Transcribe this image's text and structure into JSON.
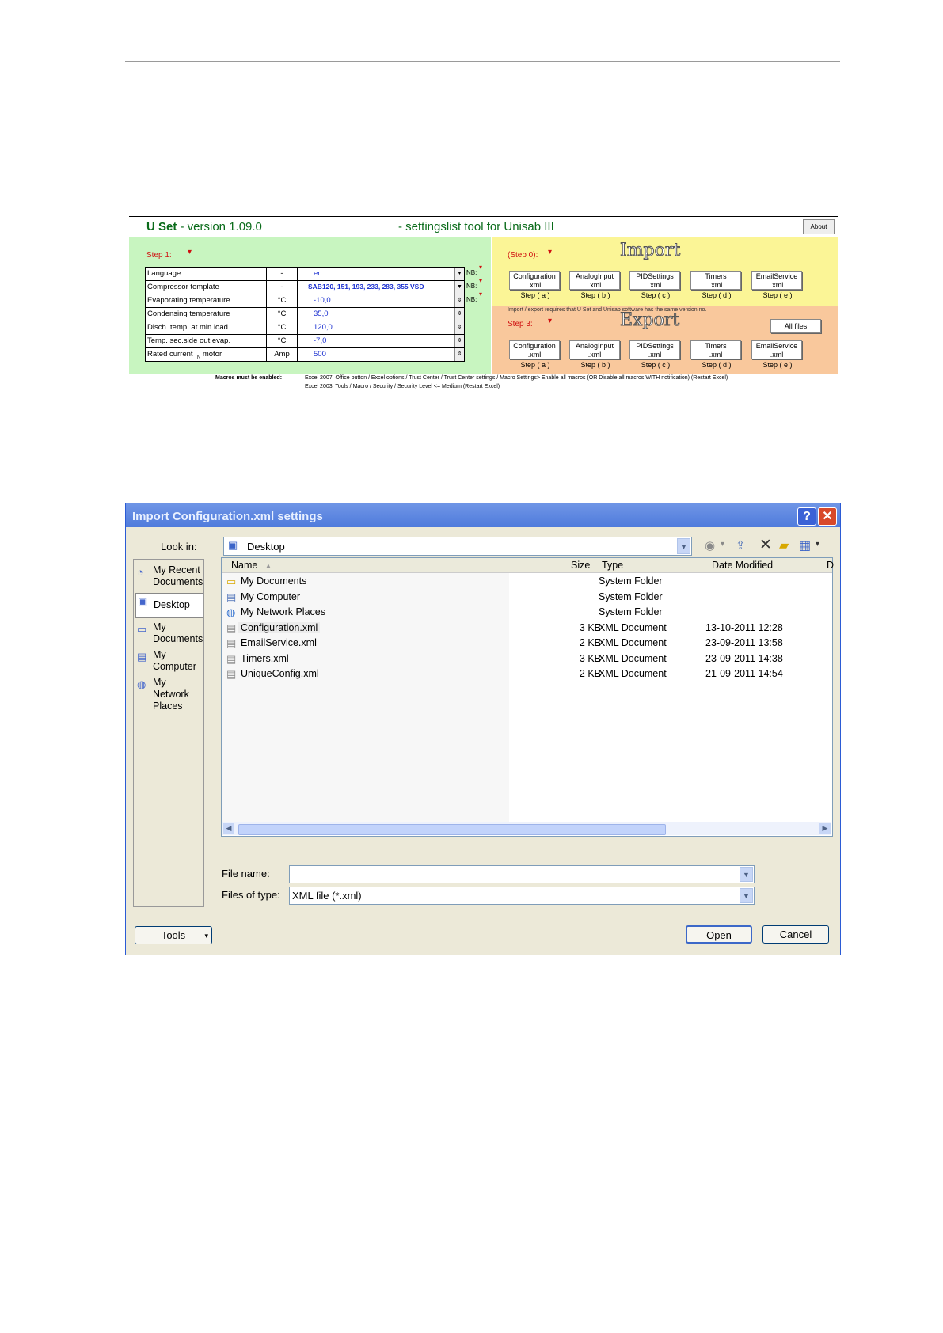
{
  "useet": {
    "title_main": "U Set",
    "title_version": " - version 1.09.0",
    "title_sub": "- settingslist tool for Unisab III",
    "about_label": "About",
    "step1_label": "Step 1:",
    "params": [
      {
        "name": "Language",
        "unit": "-",
        "value": "en",
        "nb": "NB:",
        "has_dd": true
      },
      {
        "name": "Compressor template",
        "unit": "-",
        "value": "SAB120, 151, 193, 233, 283, 355 VSD",
        "nb": "NB:",
        "has_dd": true
      },
      {
        "name": "Evaporating temperature",
        "unit": "°C",
        "value": "-10,0",
        "nb": "NB:",
        "has_dd": false
      },
      {
        "name": "Condensing temperature",
        "unit": "°C",
        "value": "35,0",
        "nb": "",
        "has_dd": false
      },
      {
        "name": "Disch. temp. at min load",
        "unit": "°C",
        "value": "120,0",
        "nb": "",
        "has_dd": false
      },
      {
        "name": "Temp. sec.side out evap.",
        "unit": "°C",
        "value": "-7,0",
        "nb": "",
        "has_dd": false
      },
      {
        "name": "Rated current I",
        "name_sub": "N",
        "name_end": " motor",
        "unit": "Amp",
        "value": "500",
        "nb": "",
        "has_dd": false
      }
    ],
    "step0_label": "(Step 0):",
    "import_wordart": "Import",
    "step3_label": "Step 3:",
    "export_wordart": "Export",
    "all_files_label": "All files",
    "import_note": "Import / export requires that U Set and Unisab software has the same version no.",
    "import_buttons": [
      {
        "line1": "Configuration",
        "line2": ".xml",
        "step": "Step ( a )"
      },
      {
        "line1": "AnalogInput",
        "line2": ".xml",
        "step": "Step ( b )"
      },
      {
        "line1": "PIDSettings",
        "line2": ".xml",
        "step": "Step ( c )"
      },
      {
        "line1": "Timers",
        "line2": ".xml",
        "step": "Step ( d )"
      },
      {
        "line1": "EmailService",
        "line2": ".xml",
        "step": "Step ( e )"
      }
    ],
    "export_buttons": [
      {
        "line1": "Configuration",
        "line2": ".xml",
        "step": "Step ( a )"
      },
      {
        "line1": "AnalogInput",
        "line2": ".xml",
        "step": "Step ( b )"
      },
      {
        "line1": "PIDSettings",
        "line2": ".xml",
        "step": "Step ( c )"
      },
      {
        "line1": "Timers",
        "line2": ".xml",
        "step": "Step ( d )"
      },
      {
        "line1": "EmailService",
        "line2": ".xml",
        "step": "Step ( e )"
      }
    ],
    "macros_label": "Macros must be enabled:",
    "macros_line1": "Excel 2007: Office button / Excel options / Trust Center / Trust Center settings / Macro Settings> Enable all macros (OR Disable all macros WITH notification) (Restart Excel)",
    "macros_line2": "Excel 2003: Tools / Macro / Security / Security Level <= Medium (Restart Excel)"
  },
  "dialog": {
    "title": "Import Configuration.xml settings",
    "look_in_label": "Look in:",
    "look_in_value": "Desktop",
    "places": [
      {
        "label": "My Recent Documents",
        "icon": "recent-documents-icon"
      },
      {
        "label": "Desktop",
        "icon": "desktop-icon"
      },
      {
        "label": "My Documents",
        "icon": "my-documents-icon"
      },
      {
        "label": "My Computer",
        "icon": "my-computer-icon"
      },
      {
        "label": "My Network Places",
        "icon": "network-places-icon"
      }
    ],
    "columns": {
      "name": "Name",
      "size": "Size",
      "type": "Type",
      "date": "Date Modified",
      "extra": "D"
    },
    "files": [
      {
        "name": "My Documents",
        "size": "",
        "type": "System Folder",
        "date": "",
        "icon": "folder-icon"
      },
      {
        "name": "My Computer",
        "size": "",
        "type": "System Folder",
        "date": "",
        "icon": "computer-icon"
      },
      {
        "name": "My Network Places",
        "size": "",
        "type": "System Folder",
        "date": "",
        "icon": "network-icon"
      },
      {
        "name": "Configuration.xml",
        "size": "3 KB",
        "type": "XML Document",
        "date": "13-10-2011 12:28",
        "icon": "xml-file-icon"
      },
      {
        "name": "EmailService.xml",
        "size": "2 KB",
        "type": "XML Document",
        "date": "23-09-2011 13:58",
        "icon": "xml-file-icon"
      },
      {
        "name": "Timers.xml",
        "size": "3 KB",
        "type": "XML Document",
        "date": "23-09-2011 14:38",
        "icon": "xml-file-icon"
      },
      {
        "name": "UniqueConfig.xml",
        "size": "2 KB",
        "type": "XML Document",
        "date": "21-09-2011 14:54",
        "icon": "xml-file-icon"
      }
    ],
    "file_name_label": "File name:",
    "file_name_value": "",
    "files_of_type_label": "Files of type:",
    "files_of_type_value": "XML file (*.xml)",
    "tools_label": "Tools",
    "open_label": "Open",
    "cancel_label": "Cancel"
  }
}
